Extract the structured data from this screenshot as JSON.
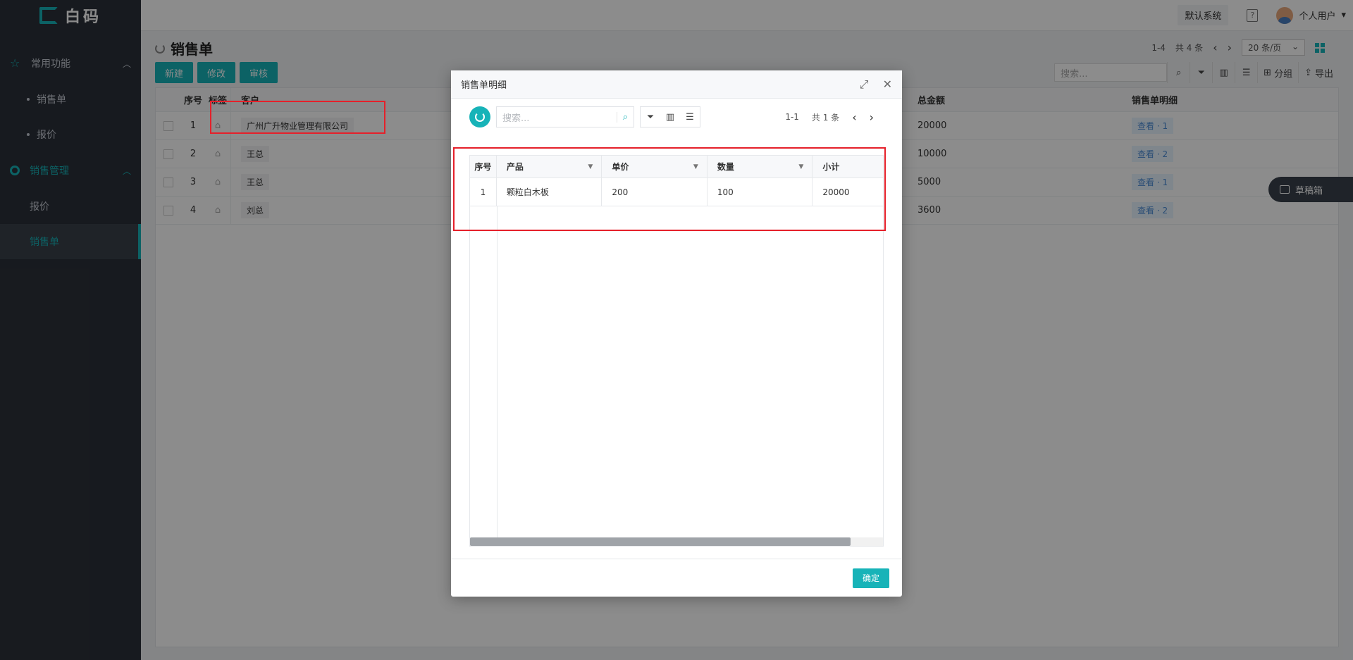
{
  "app": {
    "logo_text": "白码"
  },
  "sidebar": {
    "groups": [
      {
        "label": "常用功能",
        "items": [
          "销售单",
          "报价"
        ]
      },
      {
        "label": "销售管理",
        "items": [
          "报价",
          "销售单"
        ]
      }
    ],
    "active_item": "销售单",
    "accent": "#17b3b8"
  },
  "topbar": {
    "system": "默认系统",
    "user": "个人用户"
  },
  "page": {
    "title": "销售单",
    "pager": {
      "range": "1-4",
      "total_label": "共 4 条",
      "page_size": "20 条/页"
    },
    "buttons": [
      "新建",
      "修改",
      "审核"
    ],
    "search_placeholder": "搜索...",
    "tools": {
      "group": "分组",
      "export": "导出"
    },
    "columns": {
      "no": "序号",
      "tag": "标签",
      "customer": "客户",
      "total": "总金额",
      "detail": "销售单明细"
    },
    "rows": [
      {
        "no": "1",
        "customer": "广州广升物业管理有限公司",
        "total": "20000",
        "detail": "查看 · 1"
      },
      {
        "no": "2",
        "customer": "王总",
        "total": "10000",
        "detail": "查看 · 2"
      },
      {
        "no": "3",
        "customer": "王总",
        "total": "5000",
        "detail": "查看 · 1"
      },
      {
        "no": "4",
        "customer": "刘总",
        "total": "3600",
        "detail": "查看 · 2"
      }
    ],
    "drafts_label": "草稿箱"
  },
  "modal": {
    "title": "销售单明细",
    "search_placeholder": "搜索...",
    "pager": {
      "range": "1-1",
      "total_label": "共 1 条"
    },
    "columns": {
      "no": "序号",
      "product": "产品",
      "price": "单价",
      "qty": "数量",
      "subtotal": "小计"
    },
    "rows": [
      {
        "no": "1",
        "product": "颗粒白木板",
        "price": "200",
        "qty": "100",
        "subtotal": "20000"
      }
    ],
    "confirm": "确定"
  }
}
